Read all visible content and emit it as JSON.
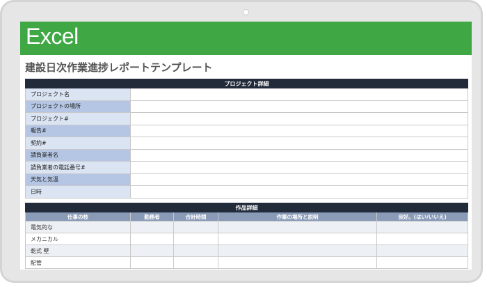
{
  "banner": {
    "title": "Excel"
  },
  "page": {
    "title": "建設日次作業進捗レポートテンプレート"
  },
  "project_section": {
    "header": "プロジェクト詳細",
    "rows": [
      {
        "label": "プロジェクト名",
        "value": ""
      },
      {
        "label": "プロジェクトの場所",
        "value": ""
      },
      {
        "label": "プロジェクト#",
        "value": ""
      },
      {
        "label": "報告#",
        "value": ""
      },
      {
        "label": "契約#",
        "value": ""
      },
      {
        "label": "請負業者名",
        "value": ""
      },
      {
        "label": "請負業者の電話番号#",
        "value": ""
      },
      {
        "label": "天気と気温",
        "value": ""
      },
      {
        "label": "日時",
        "value": ""
      }
    ]
  },
  "work_section": {
    "header": "作品詳細",
    "columns": [
      "仕事の枝",
      "勤務者",
      "合計時間",
      "作業の場所と説明",
      "良好。(はい/いいえ)"
    ],
    "rows": [
      {
        "trade": "電気的な"
      },
      {
        "trade": "メカニカル"
      },
      {
        "trade": "乾式 壁"
      },
      {
        "trade": "配管"
      }
    ]
  }
}
